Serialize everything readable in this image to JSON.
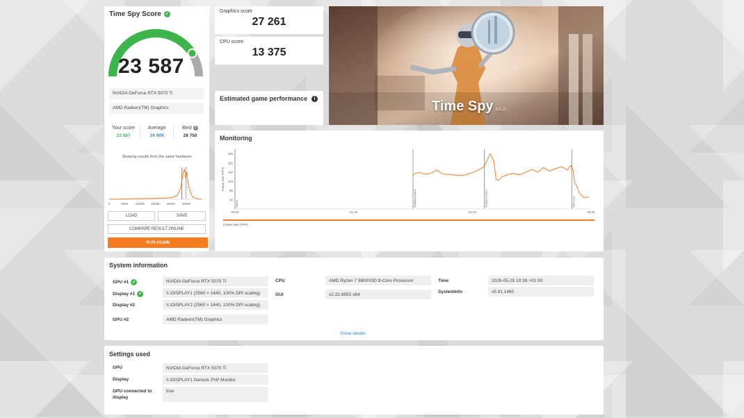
{
  "score_card": {
    "title": "Time Spy Score",
    "score": "23 587",
    "gauge_fraction": 0.82,
    "gpu": "NVIDIA GeForce RTX 5070 Ti",
    "gpu2": "AMD Radeon(TM) Graphics",
    "stats": {
      "your_label": "Your score",
      "your_value": "23 587",
      "avg_label": "Average",
      "avg_value": "24 909",
      "best_label": "Best",
      "best_value": "28 750"
    },
    "same_hw_text": "Showing results from the same hardware",
    "dist_ticks": [
      "0",
      "5000",
      "10000",
      "15000",
      "20000",
      "25000"
    ],
    "load_label": "LOAD",
    "save_label": "SAVE",
    "compare_label": "COMPARE RESULT ONLINE",
    "run_label": "RUN AGAIN"
  },
  "graphics": {
    "label": "Graphics score",
    "value": "27 261"
  },
  "cpu": {
    "label": "CPU score",
    "value": "13 375"
  },
  "estimated": {
    "label": "Estimated game performance"
  },
  "hero": {
    "title": "Time Spy",
    "version": "(v1.2)"
  },
  "monitoring": {
    "title": "Monitoring",
    "ylabel": "Frame rate (FPS)",
    "yticks": [
      "240",
      "200",
      "160",
      "120",
      "80",
      "40"
    ],
    "xticks": [
      "00:00",
      "01:40",
      "03:20",
      "05:00"
    ],
    "markers": [
      "Demo",
      "Graphics test 1",
      "Graphics test 2",
      "CPU test"
    ],
    "legend": "Frame rate (FPS)",
    "colors": {
      "fps": "#f47b20"
    }
  },
  "chart_data": {
    "type": "line",
    "ylabel": "Frame rate (FPS)",
    "ylim": [
      0,
      260
    ],
    "xlim": [
      0,
      300
    ],
    "series": [
      {
        "name": "Frame rate (FPS)",
        "x": [
          150,
          152,
          155,
          158,
          162,
          166,
          170,
          175,
          180,
          185,
          190,
          195,
          200,
          205,
          210,
          215,
          218,
          220,
          222,
          225,
          230,
          235,
          240,
          245,
          250,
          255,
          260,
          265,
          270,
          275,
          280,
          283,
          285,
          286,
          288,
          290,
          292,
          294,
          296,
          298
        ],
        "y": [
          145,
          155,
          160,
          155,
          152,
          158,
          170,
          152,
          150,
          148,
          145,
          150,
          158,
          170,
          185,
          240,
          210,
          130,
          125,
          140,
          150,
          155,
          148,
          160,
          172,
          160,
          180,
          165,
          175,
          185,
          170,
          190,
          170,
          120,
          100,
          70,
          60,
          50,
          52,
          50
        ]
      }
    ]
  },
  "system_info": {
    "title": "System information",
    "gpu1_label": "GPU #1",
    "gpu1_value": "NVIDIA GeForce RTX 5070 Ti",
    "display1_label": "Display #1",
    "display1_value": "\\\\.\\DISPLAY1 (2560 × 1440, 100% DPI scaling)",
    "display2_label": "Display #2",
    "display2_value": "\\\\.\\DISPLAY2 (2560 × 1440, 100% DPI scaling)",
    "gpu2_label": "GPU #2",
    "gpu2_value": "AMD Radeon(TM) Graphics",
    "cpu_label": "CPU",
    "cpu_value": "AMD Ryzen 7 9800X3D 8-Core Processor",
    "gui_label": "GUI",
    "gui_value": "v2.32.8853 s64",
    "time_label": "Time",
    "time_value": "2026-05-25 19:39 +01:00",
    "sysinfo_label": "SystemInfo",
    "sysinfo_value": "v5.91.1460",
    "show_details": "Show details"
  },
  "settings": {
    "title": "Settings used",
    "gpu_label": "GPU",
    "gpu_value": "NVIDIA GeForce RTX 5070 Ti",
    "display_label": "Display",
    "display_value": "\\\\.\\DISPLAY1 Generic PnP Monitor",
    "connected_label": "GPU connected to display",
    "connected_value": "true"
  }
}
